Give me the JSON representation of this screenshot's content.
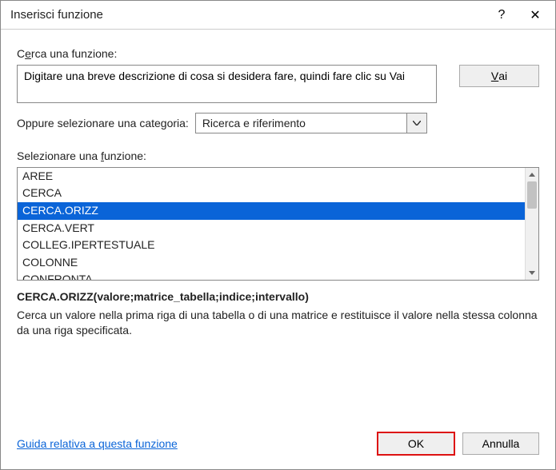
{
  "titlebar": {
    "title": "Inserisci funzione",
    "help": "?",
    "close": "✕"
  },
  "search": {
    "label_pre": "C",
    "label_u": "e",
    "label_post": "rca una funzione:",
    "text": "Digitare una breve descrizione di cosa si desidera fare, quindi fare clic su Vai",
    "go_u": "V",
    "go_post": "ai"
  },
  "category": {
    "label": "Oppure selezionare una categoria:",
    "value": "Ricerca e riferimento"
  },
  "listlabel": {
    "pre": "Selezionare una ",
    "u": "f",
    "post": "unzione:"
  },
  "functions": [
    {
      "name": "AREE",
      "selected": false
    },
    {
      "name": "CERCA",
      "selected": false
    },
    {
      "name": "CERCA.ORIZZ",
      "selected": true
    },
    {
      "name": "CERCA.VERT",
      "selected": false
    },
    {
      "name": "COLLEG.IPERTESTUALE",
      "selected": false
    },
    {
      "name": "COLONNE",
      "selected": false
    },
    {
      "name": "CONFRONTA",
      "selected": false
    }
  ],
  "signature": "CERCA.ORIZZ(valore;matrice_tabella;indice;intervallo)",
  "description": "Cerca un valore nella prima riga di una tabella o di una matrice e restituisce il valore nella stessa colonna da una riga specificata.",
  "footer": {
    "help": "Guida relativa a questa funzione",
    "ok": "OK",
    "cancel": "Annulla"
  }
}
